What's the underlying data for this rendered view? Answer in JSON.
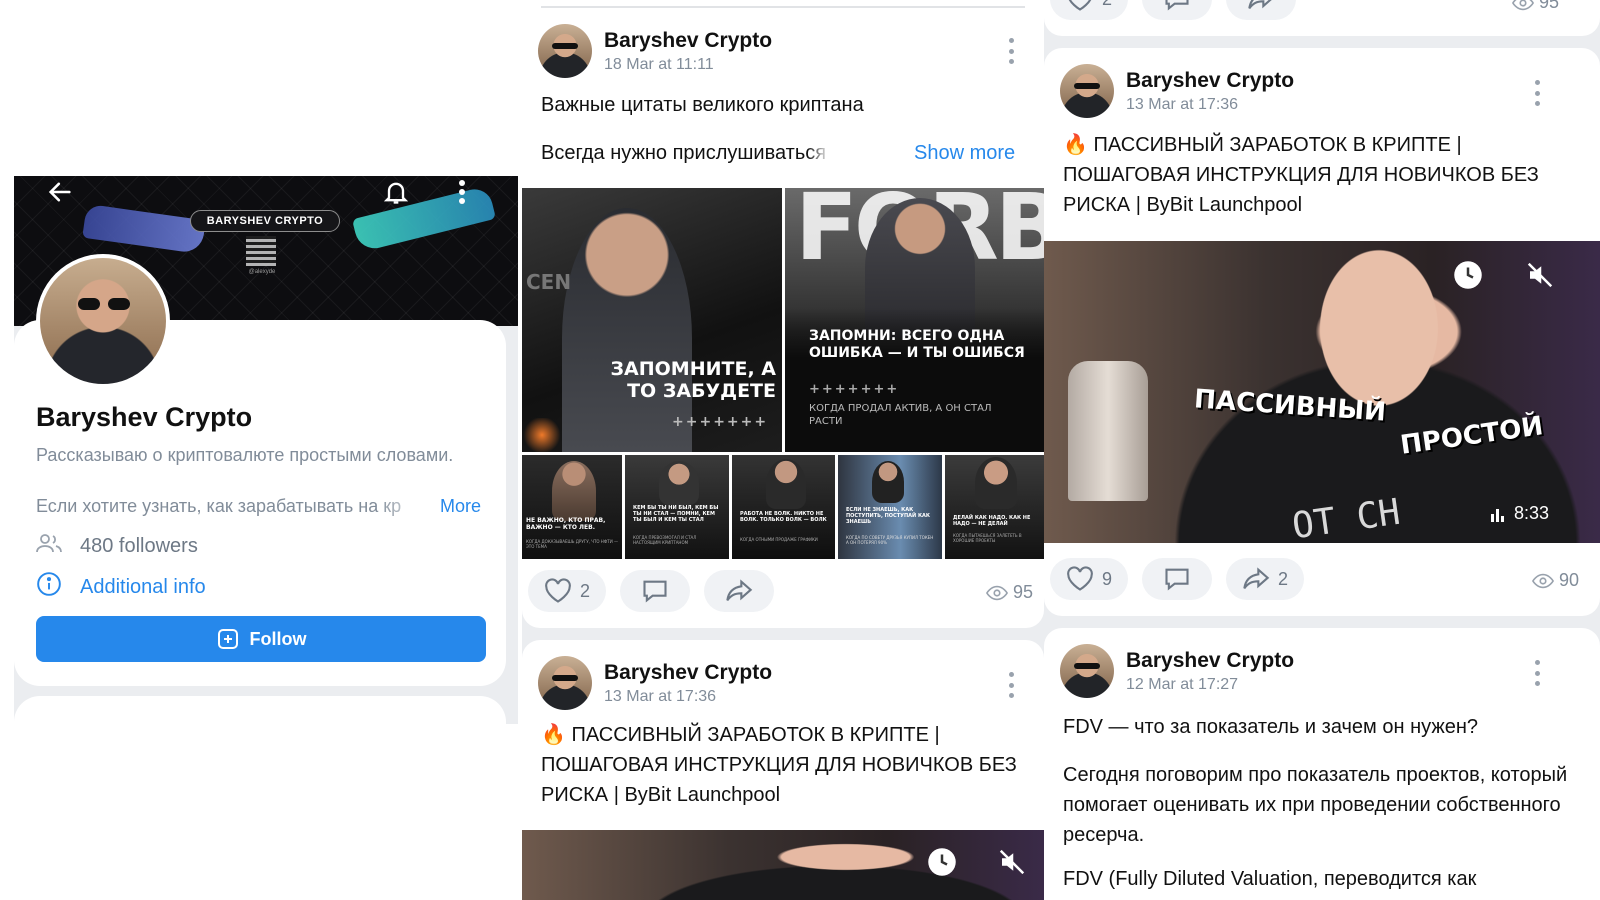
{
  "profile": {
    "cover_brand": "BARYSHEV CRYPTO",
    "cover_handle": "@alexyde",
    "name": "Baryshev Crypto",
    "description": "Рассказываю о криптовалюте простыми словами.",
    "description_line2": "Если хотите узнать, как зарабатывать на кр",
    "more": "More",
    "followers": "480 followers",
    "additional_info": "Additional info",
    "follow_button": "Follow"
  },
  "author": "Baryshev Crypto",
  "col2": {
    "post1": {
      "date": "18 Mar at 11:11",
      "title": "Важные цитаты великого криптана",
      "text": "Всегда нужно прислушиваться к от",
      "show_more": "Show more",
      "img1_caption": "ЗАПОМНИТЕ, А ТО ЗАБУДЕТЕ",
      "img1_sub": "+++++++",
      "img2_caption": "ЗАПОМНИ: ВСЕГО ОДНА ОШИБКА — И ТЫ ОШИБСЯ",
      "img2_plus": "+++++++",
      "img2_sub": "КОГДА ПРОДАЛ АКТИВ, А ОН СТАЛ РАСТИ",
      "img2_bg": "FORB",
      "img1_side": "CEN",
      "thumbs": [
        {
          "caption": "НЕ ВАЖНО, КТО ПРАВ, ВАЖНО — КТО ЛЕВ.",
          "sub": "КОГДА ДОКАЗЫВАЕШЬ ДРУГУ, ЧТО НФТИ — ЭТО ТЕМА"
        },
        {
          "caption": "КЕМ БЫ ТЫ НИ БЫЛ, КЕМ БЫ ТЫ НИ СТАЛ — ПОМНИ, КЕМ ТЫ БЫЛ И КЕМ ТЫ СТАЛ",
          "sub": "КОГДА ПРЕВОЗМОГАЛ И СТАЛ НАСТОЯЩИМ КРИПТАНОМ"
        },
        {
          "caption": "РАБОТА НЕ ВОЛК. НИКТО НЕ ВОЛК. ТОЛЬКО ВОЛК — ВОЛК",
          "sub": "КОГДА ОТНЫМИ ПРОДАЖЕ ГРАФИКИ"
        },
        {
          "caption": "ЕСЛИ НЕ ЗНАЕШЬ, КАК ПОСТУПИТЬ, ПОСТУПАЙ КАК ЗНАЕШЬ",
          "sub": "КОГДА ПО СОВЕТУ ДРУЗЬЯ КУПИЛ ТОКЕН А ОН ПОТЕРЯЛ 90%"
        },
        {
          "caption": "ДЕЛАЙ КАК НАДО. КАК НЕ НАДО — НЕ ДЕЛАЙ",
          "sub": "КОГДА ПЫТАЕШЬСЯ ЗАЛЕТЕТЬ В ХОРОШИЕ ПРОЕКТЫ"
        }
      ],
      "likes": "2",
      "views": "95"
    },
    "post2": {
      "date": "13 Mar at 17:36",
      "title": "ПАССИВНЫЙ ЗАРАБОТОК В КРИПТЕ | ПОШАГОВАЯ ИНСТРУКЦИЯ ДЛЯ НОВИЧКОВ БЕЗ РИСКА | ByBit Launchpool",
      "emoji": "🔥"
    }
  },
  "col3": {
    "top_actions": {
      "likes": "2",
      "views": "95"
    },
    "post1": {
      "date": "13 Mar at 17:36",
      "emoji": "🔥",
      "title": "ПАССИВНЫЙ ЗАРАБОТОК В КРИПТЕ | ПОШАГОВАЯ ИНСТРУКЦИЯ ДЛЯ НОВИЧКОВ БЕЗ РИСКА | ByBit Launchpool",
      "video_caption1": "ПАССИВНЫЙ",
      "video_caption2": "ПРОСТОЙ",
      "video_shirt": "OT CH",
      "duration": "8:33",
      "likes": "9",
      "shares": "2",
      "views": "90"
    },
    "post2": {
      "date": "12 Mar at 17:27",
      "title": "FDV — что за показатель и зачем он нужен?",
      "text": "Сегодня поговорим про показатель проектов, который помогает оценивать их при проведении собственного ресерча.",
      "text2": "FDV (Fully Diluted Valuation, переводится как"
    }
  },
  "colors": {
    "accent": "#2688eb",
    "secondary_text": "#818c99",
    "bg": "#ebedf0"
  }
}
